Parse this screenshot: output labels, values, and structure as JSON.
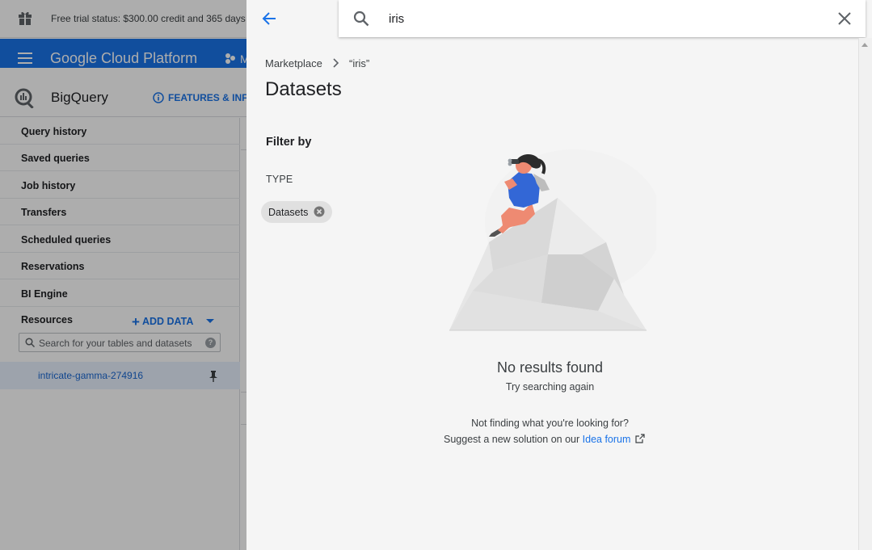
{
  "background": {
    "trial_status": "Free trial status: $300.00 credit and 365 days",
    "platform_title": "Google Cloud Platform",
    "project_truncated": "M",
    "product_title": "BigQuery",
    "features_label": "FEATURES & INF",
    "nav_items": [
      {
        "label": "Query history"
      },
      {
        "label": "Saved queries"
      },
      {
        "label": "Job history"
      },
      {
        "label": "Transfers"
      },
      {
        "label": "Scheduled queries"
      },
      {
        "label": "Reservations"
      },
      {
        "label": "BI Engine"
      }
    ],
    "resources_label": "Resources",
    "add_data_label": "ADD DATA",
    "resource_search_placeholder": "Search for your tables and datasets",
    "project_id": "intricate-gamma-274916"
  },
  "search": {
    "value": "iris"
  },
  "breadcrumb": {
    "root": "Marketplace",
    "current": "“iris”"
  },
  "page_title": "Datasets",
  "filters": {
    "heading": "Filter by",
    "type_label": "TYPE",
    "active_chip": "Datasets"
  },
  "empty_state": {
    "title": "No results found",
    "subtitle": "Try searching again",
    "not_finding": "Not finding what you're looking for?",
    "suggest_prefix": "Suggest a new solution on our ",
    "idea_link": "Idea forum"
  },
  "colors": {
    "accent": "#1a73e8",
    "panel_bg": "#f5f5f5",
    "scrim": "rgba(0,0,0,0.32)"
  }
}
